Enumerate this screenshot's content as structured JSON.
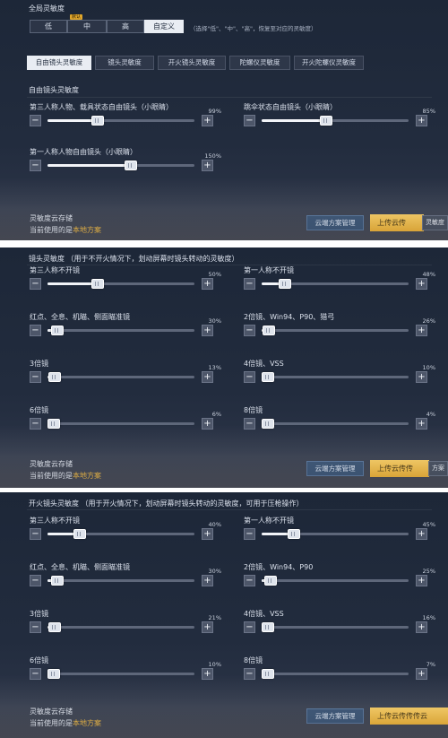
{
  "panel1": {
    "global_label": "全局灵敏度",
    "presets": [
      "低",
      "中",
      "高",
      "自定义"
    ],
    "preset_badge": "默认",
    "preset_hint": "（选择\"低\"、\"中\"、\"高\"，恢复至对应的灵敏度）",
    "tabs": [
      "自由镜头灵敏度",
      "镜头灵敏度",
      "开火镜头灵敏度",
      "陀螺仪灵敏度",
      "开火陀螺仪灵敏度"
    ],
    "section": "自由镜头灵敏度",
    "sliders": [
      {
        "label": "第三人称人物、载具状态自由镜头（小眼睛）",
        "percent": "99%",
        "value": 0.34
      },
      {
        "label": "跳伞状态自由镜头（小眼睛）",
        "percent": "85%",
        "value": 0.44
      },
      {
        "label": "第一人称人物自由镜头（小眼睛）",
        "percent": "150%",
        "value": 0.57
      }
    ],
    "cloud_title": "灵敏度云存储",
    "cloud_current": "当前使用的是",
    "cloud_scheme": "本地方案",
    "manage_button": "云端方案管理",
    "upload_button": "上传云传",
    "mini_button": "灵敏度"
  },
  "panel2": {
    "section": "镜头灵敏度 （用于不开火情况下，划动屏幕时镜头转动的灵敏度）",
    "sliders": [
      {
        "label": "第三人称不开镜",
        "percent": "50%",
        "value": 0.34
      },
      {
        "label": "第一人称不开镜",
        "percent": "48%",
        "value": 0.16
      },
      {
        "label": "红点、全息、机瞄、侧面瞄准镜",
        "percent": "30%",
        "value": 0.07
      },
      {
        "label": "2倍镜、Win94、P90、猎弓",
        "percent": "26%",
        "value": 0.05
      },
      {
        "label": "3倍镜",
        "percent": "13%",
        "value": 0.05
      },
      {
        "label": "4倍镜、VSS",
        "percent": "10%",
        "value": 0.03
      },
      {
        "label": "6倍镜",
        "percent": "6%",
        "value": 0.02
      },
      {
        "label": "8倍镜",
        "percent": "4%",
        "value": 0.01
      }
    ],
    "cloud_title": "灵敏度云存储",
    "cloud_current": "当前使用的是",
    "cloud_scheme": "本地方案",
    "manage_button": "云端方案管理",
    "upload_button": "上传云传传",
    "mini_button": "方案"
  },
  "panel3": {
    "section": "开火镜头灵敏度 （用于开火情况下，划动屏幕时镜头转动的灵敏度，可用于压枪操作）",
    "sliders": [
      {
        "label": "第三人称不开镜",
        "percent": "40%",
        "value": 0.22
      },
      {
        "label": "第一人称不开镜",
        "percent": "45%",
        "value": 0.22
      },
      {
        "label": "红点、全息、机瞄、侧面瞄准镜",
        "percent": "30%",
        "value": 0.07
      },
      {
        "label": "2倍镜、Win94、P90",
        "percent": "25%",
        "value": 0.06
      },
      {
        "label": "3倍镜",
        "percent": "21%",
        "value": 0.05
      },
      {
        "label": "4倍镜、VSS",
        "percent": "16%",
        "value": 0.04
      },
      {
        "label": "6倍镜",
        "percent": "10%",
        "value": 0.02
      },
      {
        "label": "8倍镜",
        "percent": "7%",
        "value": 0.02
      }
    ],
    "cloud_title": "灵敏度云存储",
    "cloud_current": "当前使用的是",
    "cloud_scheme": "本地方案",
    "manage_button": "云端方案管理",
    "upload_button": "上传云传传传云"
  }
}
